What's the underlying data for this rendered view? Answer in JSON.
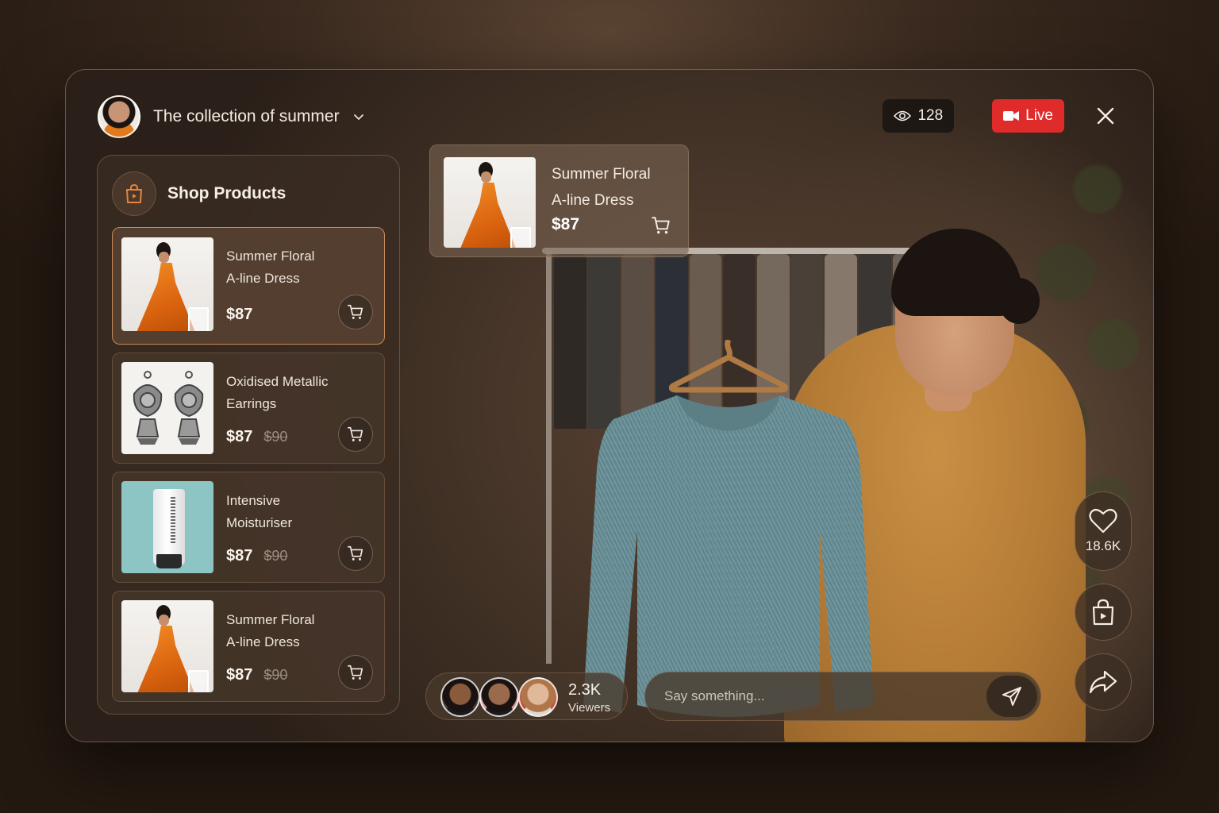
{
  "header": {
    "collection_title": "The collection of summer",
    "viewer_count": "128",
    "live_label": "Live"
  },
  "shop": {
    "title": "Shop Products",
    "products": [
      {
        "name_line1": "Summer Floral",
        "name_line2": "A-line Dress",
        "price": "$87",
        "old_price": ""
      },
      {
        "name_line1": "Oxidised Metallic",
        "name_line2": "Earrings",
        "price": "$87",
        "old_price": "$90"
      },
      {
        "name_line1": "Intensive",
        "name_line2": "Moisturiser",
        "price": "$87",
        "old_price": "$90"
      },
      {
        "name_line1": "Summer Floral",
        "name_line2": "A-line Dress",
        "price": "$87",
        "old_price": "$90"
      }
    ]
  },
  "featured": {
    "name_line1": "Summer Floral",
    "name_line2": "A-line Dress",
    "price": "$87"
  },
  "actions": {
    "like_count": "18.6K"
  },
  "viewers": {
    "count": "2.3K",
    "label": "Viewers"
  },
  "chat": {
    "placeholder": "Say something..."
  },
  "colors": {
    "accent": "#e8843a",
    "live": "#e02b2b"
  },
  "icons": [
    "eye-icon",
    "video-camera-icon",
    "close-icon",
    "chevron-down-icon",
    "shopping-bag-icon",
    "cart-icon",
    "heart-icon",
    "share-arrow-icon",
    "send-icon"
  ]
}
